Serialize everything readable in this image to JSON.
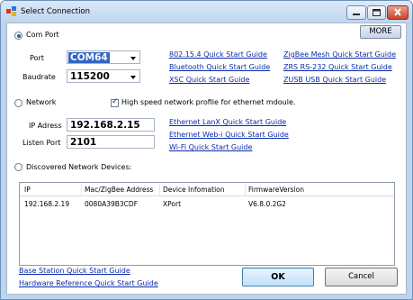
{
  "window": {
    "title": "Select Connection"
  },
  "com_port": {
    "radio_label": "Com Port",
    "port_label": "Port",
    "port_value": "COM64",
    "baudrate_label": "Baudrate",
    "baudrate_value": "115200",
    "more_button": "MORE",
    "guides": [
      "802.15.4 Quick Start Guide",
      "ZigBee Mesh Quick Start Guide",
      "Bluetooth Quick Start Guide",
      "ZRS RS-232 Quick Start Guide",
      "XSC Quick Start Guide",
      "ZUSB USB Quick Start Guide"
    ]
  },
  "network": {
    "radio_label": "Network",
    "high_speed_label": "High speed network profile for ethernet mdoule.",
    "ip_label": "IP Adress",
    "ip_value": "192.168.2.15",
    "listen_port_label": "Listen Port",
    "listen_port_value": "2101",
    "guides": [
      "Ethernet LanX Quick Start Guide",
      "Ethernet Web-i Quick Start Guide",
      "Wi-Fi Quick Start Guide"
    ]
  },
  "discovered": {
    "radio_label": "Discovered Network Devices:",
    "columns": [
      "IP",
      "Mac/ZigBee Address",
      "Device Infomation",
      "FirmwareVersion"
    ],
    "rows": [
      [
        "192.168.2.19",
        "0080A39B3CDF",
        "XPort",
        "V6.8.0.2G2"
      ]
    ]
  },
  "footer": {
    "base_station_link": "Base Station Quick Start Guide",
    "hardware_link": "Hardware Reference Quick Start Guide",
    "ok_button": "OK",
    "cancel_button": "Cancel"
  }
}
